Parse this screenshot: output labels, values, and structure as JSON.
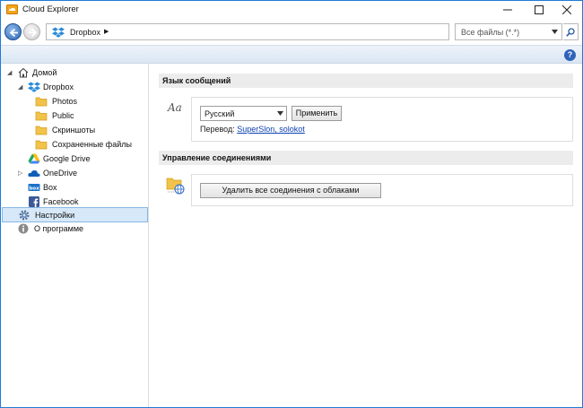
{
  "window": {
    "title": "Cloud Explorer"
  },
  "address_bar": {
    "breadcrumb": "Dropbox",
    "crumb_arrow": "▶"
  },
  "filter": {
    "value": "Все файлы (*.*)"
  },
  "help": {
    "label": "?"
  },
  "sidebar": {
    "items": [
      {
        "label": "Домой",
        "icon": "home-icon",
        "expander": "◢",
        "level": 0
      },
      {
        "label": "Dropbox",
        "icon": "dropbox-icon",
        "expander": "◢",
        "level": 1
      },
      {
        "label": "Photos",
        "icon": "folder-icon",
        "expander": "",
        "level": 2
      },
      {
        "label": "Public",
        "icon": "folder-icon",
        "expander": "",
        "level": 2
      },
      {
        "label": "Скриншоты",
        "icon": "folder-icon",
        "expander": "",
        "level": 2
      },
      {
        "label": "Сохраненные файлы",
        "icon": "folder-icon",
        "expander": "",
        "level": 2
      },
      {
        "label": "Google Drive",
        "icon": "google-drive-icon",
        "expander": "",
        "level": 1
      },
      {
        "label": "OneDrive",
        "icon": "onedrive-icon",
        "expander": "▷",
        "level": 1
      },
      {
        "label": "Box",
        "icon": "box-icon",
        "expander": "",
        "level": 1
      },
      {
        "label": "Facebook",
        "icon": "facebook-icon",
        "expander": "",
        "level": 1
      },
      {
        "label": "Настройки",
        "icon": "gear-icon",
        "expander": "",
        "level": 0,
        "selected": true
      },
      {
        "label": "О программе",
        "icon": "info-icon",
        "expander": "",
        "level": 0
      }
    ]
  },
  "settings": {
    "language_section": {
      "title": "Язык сообщений",
      "aa_glyph": "Aa",
      "language_value": "Русский",
      "apply_label": "Применить",
      "translation_prefix": "Перевод:",
      "translation_authors": "SuperSlon, solokot"
    },
    "connections_section": {
      "title": "Управление соединениями",
      "delete_all_label": "Удалить все соединения с облаками"
    }
  },
  "colors": {
    "accent": "#1e7bd8",
    "selection_bg": "#d7e8f8",
    "link": "#0b3fb5"
  }
}
